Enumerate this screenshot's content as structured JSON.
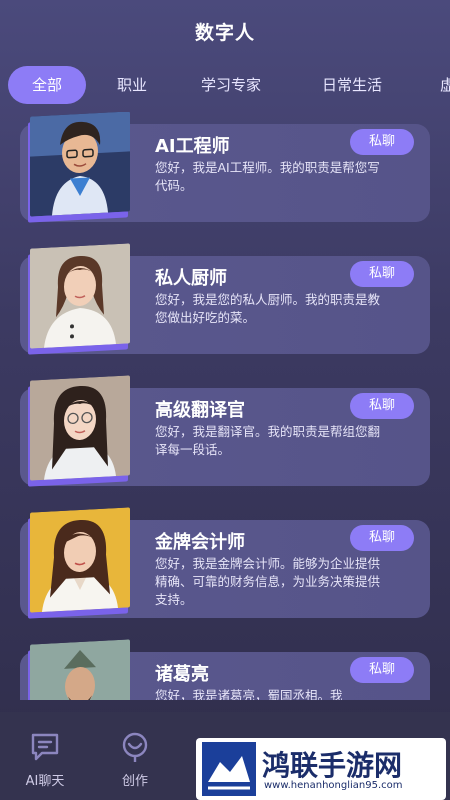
{
  "header": {
    "title": "数字人"
  },
  "tabs": [
    {
      "label": "全部",
      "active": true
    },
    {
      "label": "职业"
    },
    {
      "label": "学习专家"
    },
    {
      "label": "日常生活"
    },
    {
      "label": "虚"
    }
  ],
  "cards": [
    {
      "title": "AI工程师",
      "desc": "您好，我是AI工程师。我的职责是帮您写代码。",
      "button": "私聊"
    },
    {
      "title": "私人厨师",
      "desc": "您好，我是您的私人厨师。我的职责是教您做出好吃的菜。",
      "button": "私聊"
    },
    {
      "title": "高级翻译官",
      "desc": "您好，我是翻译官。我的职责是帮组您翻译每一段话。",
      "button": "私聊"
    },
    {
      "title": "金牌会计师",
      "desc": "您好，我是金牌会计师。能够为企业提供精确、可靠的财务信息，为业务决策提供支持。",
      "button": "私聊"
    },
    {
      "title": "诸葛亮",
      "desc": "您好，我是诸葛亮，蜀国丞相。我",
      "button": "私聊"
    }
  ],
  "bottom_nav": [
    {
      "label": "AI聊天",
      "icon": "chat-icon"
    },
    {
      "label": "创作",
      "icon": "create-icon"
    }
  ],
  "watermark": {
    "name": "鸿联手游网",
    "url": "www.henanhonglian95.com"
  },
  "colors": {
    "accent": "#8d7cf6",
    "card": "#5a588e",
    "thumb_shadow": "#7a63ea"
  }
}
